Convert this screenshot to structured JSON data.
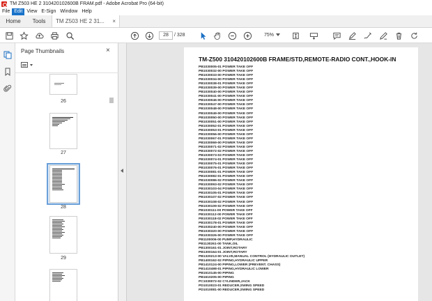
{
  "window": {
    "title": "TM Z503 HE  2 310420102600B FRAM.pdf - Adobe Acrobat Pro (64-bit)"
  },
  "menu": [
    "File",
    "Edit",
    "View",
    "E-Sign",
    "Window",
    "Help"
  ],
  "tabs": {
    "home": "Home",
    "tools": "Tools",
    "document": "TM Z503 HE  2 31...",
    "close": "×"
  },
  "toolbar": {
    "page_current": "28",
    "page_total": "/  328",
    "zoom": "75%"
  },
  "panel": {
    "title": "Page Thumbnails",
    "close": "×"
  },
  "thumbnails": [
    {
      "label": "26"
    },
    {
      "label": "27"
    },
    {
      "label": "28",
      "selected": true
    },
    {
      "label": "29"
    }
  ],
  "document": {
    "heading": "TM-Z500 310420102600B FRAME/STD,REMOTE-RADIO CONT.,HOOK-IN",
    "lines": [
      "PB1030005-01 POWER TAKE OFF",
      "PB1030032-00 POWER TAKE OFF",
      "PB1030033-00 POWER TAKE OFF",
      "PB1030034-00 POWER TAKE OFF",
      "PB1030038-01 POWER TAKE OFF",
      "PB1030039-00 POWER TAKE OFF",
      "PB1030040-00 POWER TAKE OFF",
      "PB1030041-00 POWER TAKE OFF",
      "PB1030046-00 POWER TAKE OFF",
      "PB1030047-00 POWER TAKE OFF",
      "PB1030048-00 POWER TAKE OFF",
      "PB1030049-00 POWER TAKE OFF",
      "PB1030050-00 POWER TAKE OFF",
      "PB1030051-00 POWER TAKE OFF",
      "PB1030052-01 POWER TAKE OFF",
      "PB1030053-01 POWER TAKE OFF",
      "PB1030056-00 POWER TAKE OFF",
      "PB1030067-01 POWER TAKE OFF",
      "PB1030069-00 POWER TAKE OFF",
      "PB1030071-02 POWER TAKE OFF",
      "PB1030072-02 POWER TAKE OFF",
      "PB1030073-03 POWER TAKE OFF",
      "PB1030074-01 POWER TAKE OFF",
      "PB1030075-01 POWER TAKE OFF",
      "PB1030076-01 POWER TAKE OFF",
      "PB1030081-01 POWER TAKE OFF",
      "PB1030082-01 POWER TAKE OFF",
      "PB1030086-02 POWER TAKE OFF",
      "PB1030093-02 POWER TAKE OFF",
      "PB1030103-04 POWER TAKE OFF",
      "PB1030105-01 POWER TAKE OFF",
      "PB1030107-02 POWER TAKE OFF",
      "PB1030108-02 POWER TAKE OFF",
      "PB1030109-02 POWER TAKE OFF",
      "PB1030111-00 POWER TAKE OFF",
      "PB1030112-00 POWER TAKE OFF",
      "PB1030118-02 POWER TAKE OFF",
      "PB1030178-01 POWER TAKE OFF",
      "PB1030240-00 POWER TAKE OFF",
      "PB1030320-00 POWER TAKE OFF",
      "PB1030326-00 POWER TAKE OFF",
      "PB1100006-00 PUMP,HYDRAULIC",
      "PB1130261-00 TANK,OIL",
      "PB1300161-01 JOINT,ROTARY",
      "PB1300164-01 JOINT,ROTARY",
      "PB1320213-00 VALVE,MANUAL CONTROL (HYDRAULIC OUTLET)",
      "PB1400162-02 PIPING,HYDRAULIC UPPER",
      "PB1410124-00 PIPING,LOWER (PREVENT. CHASS)",
      "PB1410498-01 PIPING,HYDRAULIC LOWER",
      "PB1510145-00 PIPING",
      "PB1610205-00 PIPING",
      "PC1030072-02 CYLINDER,JACK",
      "PD1010023-01 REDUCER,SWING SPEED",
      "PD1010081-00 REDUCER,SWING SPEED"
    ]
  }
}
